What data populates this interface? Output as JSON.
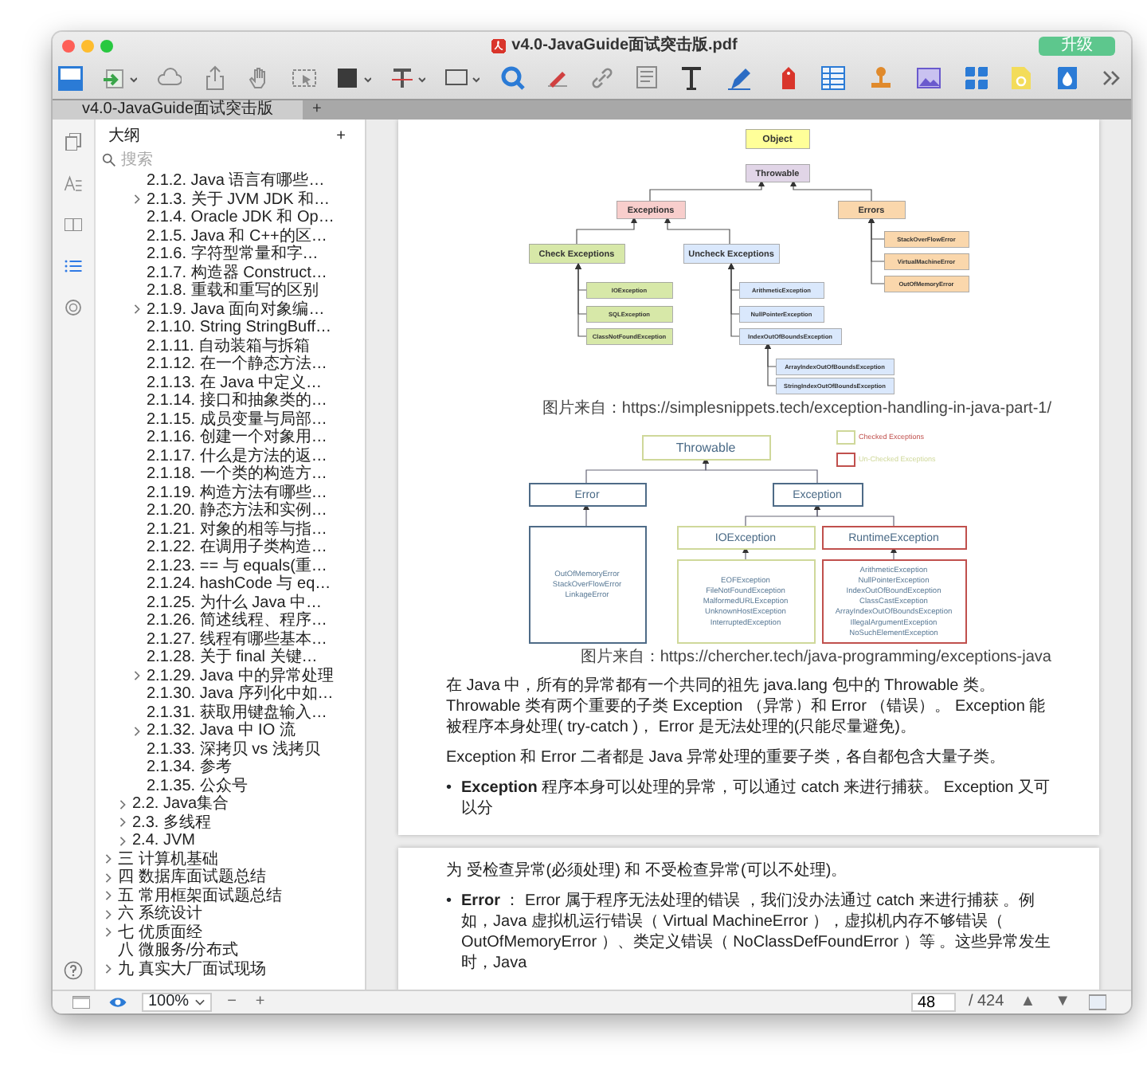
{
  "window": {
    "title": "v4.0-JavaGuide面试突击版.pdf",
    "upgrade_button": "升级"
  },
  "tabs": [
    {
      "label": "v4.0-JavaGuide面试突击版",
      "selected": true
    }
  ],
  "new_tab": "+",
  "rail": [
    {
      "kind": "pages",
      "selected": false
    },
    {
      "kind": "text",
      "selected": false
    },
    {
      "kind": "book",
      "selected": false
    },
    {
      "kind": "outline",
      "selected": true
    },
    {
      "kind": "ring",
      "selected": false
    }
  ],
  "sidebar": {
    "title": "大纲",
    "add": "+",
    "search": {
      "placeholder": "搜索"
    },
    "items": [
      {
        "children": [
          {
            "children": [
              {
                "label": "2.1.2. Java 语言有哪些…",
                "kind": "leaf"
              },
              {
                "label": "2.1.3. 关于 JVM JDK 和…",
                "kind": "folder"
              },
              {
                "label": "2.1.4. Oracle JDK 和 Op…",
                "kind": "leaf"
              },
              {
                "label": "2.1.5. Java 和 C++的区…",
                "kind": "leaf"
              },
              {
                "label": "2.1.6. 字符型常量和字…",
                "kind": "leaf"
              },
              {
                "label": "2.1.7. 构造器 Construct…",
                "kind": "leaf"
              },
              {
                "label": "2.1.8. 重载和重写的区别",
                "kind": "leaf"
              },
              {
                "label": "2.1.9. Java 面向对象编…",
                "kind": "folder"
              },
              {
                "label": "2.1.10. String StringBuff…",
                "kind": "leaf"
              },
              {
                "label": "2.1.11. 自动装箱与拆箱",
                "kind": "leaf"
              },
              {
                "label": "2.1.12. 在一个静态方法…",
                "kind": "leaf"
              },
              {
                "label": "2.1.13. 在 Java 中定义…",
                "kind": "leaf"
              },
              {
                "label": "2.1.14. 接口和抽象类的…",
                "kind": "leaf"
              },
              {
                "label": "2.1.15. 成员变量与局部…",
                "kind": "leaf"
              },
              {
                "label": "2.1.16. 创建一个对象用…",
                "kind": "leaf"
              },
              {
                "label": "2.1.17. 什么是方法的返…",
                "kind": "leaf"
              },
              {
                "label": "2.1.18. 一个类的构造方…",
                "kind": "leaf"
              },
              {
                "label": "2.1.19. 构造方法有哪些…",
                "kind": "leaf"
              },
              {
                "label": "2.1.20. 静态方法和实例…",
                "kind": "leaf"
              },
              {
                "label": "2.1.21. 对象的相等与指…",
                "kind": "leaf"
              },
              {
                "label": "2.1.22. 在调用子类构造…",
                "kind": "leaf"
              },
              {
                "label": "2.1.23. == 与 equals(重…",
                "kind": "leaf"
              },
              {
                "label": "2.1.24. hashCode 与 eq…",
                "kind": "leaf"
              },
              {
                "label": "2.1.25. 为什么 Java 中…",
                "kind": "leaf"
              },
              {
                "label": "2.1.26. 简述线程、程序…",
                "kind": "leaf"
              },
              {
                "label": "2.1.27. 线程有哪些基本…",
                "kind": "leaf"
              },
              {
                "label": "2.1.28. 关于 final 关键…",
                "kind": "leaf"
              },
              {
                "label": "2.1.29. Java 中的异常处理",
                "kind": "folder"
              },
              {
                "label": "2.1.30. Java 序列化中如…",
                "kind": "leaf"
              },
              {
                "label": "2.1.31. 获取用键盘输入…",
                "kind": "leaf"
              },
              {
                "label": "2.1.32. Java 中 IO 流",
                "kind": "folder"
              },
              {
                "label": "2.1.33. 深拷贝 vs 浅拷贝",
                "kind": "leaf"
              },
              {
                "label": "2.1.34. 参考",
                "kind": "leaf"
              },
              {
                "label": "2.1.35. 公众号",
                "kind": "leaf"
              }
            ]
          },
          {
            "label": "2.2. Java集合",
            "kind": "folder"
          },
          {
            "label": "2.3. 多线程",
            "kind": "folder"
          },
          {
            "label": "2.4. JVM",
            "kind": "folder"
          }
        ]
      },
      {
        "label": "三 计算机基础",
        "kind": "folder"
      },
      {
        "label": "四 数据库面试题总结",
        "kind": "folder"
      },
      {
        "label": "五 常用框架面试题总结",
        "kind": "folder"
      },
      {
        "label": "六 系统设计",
        "kind": "folder"
      },
      {
        "label": "七 优质面经",
        "kind": "folder"
      },
      {
        "label": "八 微服务/分布式",
        "kind": "leaf"
      },
      {
        "label": "九 真实大厂面试现场",
        "kind": "folder"
      }
    ]
  },
  "pages": [
    {
      "blocks": [
        {
          "kind": "tree_figure",
          "nodes": [
            {
              "label": "Object",
              "color": "#ffff99"
            },
            {
              "label": "Throwable",
              "color": "#e1d5e7"
            },
            {
              "label": "Exceptions",
              "color": "#f8cecc"
            },
            {
              "label": "Errors",
              "color": "#fad7ac"
            },
            {
              "label": "Check Exceptions",
              "color": "#d7e8a8"
            },
            {
              "label": "Uncheck Exceptions",
              "color": "#dae8fc"
            },
            {
              "label": "IOException",
              "color": "#d7e8a8"
            },
            {
              "label": "SQLException",
              "color": "#d7e8a8"
            },
            {
              "label": "ClassNotFoundException",
              "color": "#d7e8a8"
            },
            {
              "label": "ArithmeticException",
              "color": "#dae8fc"
            },
            {
              "label": "NullPointerException",
              "color": "#dae8fc"
            },
            {
              "label": "IndexOutOfBoundsException",
              "color": "#dae8fc"
            },
            {
              "label": "ArrayIndexOutOfBoundsException",
              "color": "#dae8fc"
            },
            {
              "label": "StringIndexOutOfBoundsException",
              "color": "#dae8fc"
            },
            {
              "label": "StackOverFlowError",
              "color": "#fad7ac"
            },
            {
              "label": "VirtualMachineError",
              "color": "#fad7ac"
            },
            {
              "label": "OutOfMemoryError",
              "color": "#fad7ac"
            }
          ]
        },
        {
          "kind": "caption",
          "text": "图片来自：https://simplesnippets.tech/exception-handling-in-java-part-1/"
        },
        {
          "kind": "box_figure",
          "legend": [
            {
              "label": "Checked Exceptions",
              "color": "#cfd89a"
            },
            {
              "label": "Un-Checked Exceptions",
              "color": "#c0504d"
            }
          ],
          "nodes": [
            {
              "label": "Throwable",
              "color": "#cfd89a"
            },
            {
              "label": "Error",
              "color": "#4e6b87"
            },
            {
              "label": "Exception",
              "color": "#4e6b87"
            },
            {
              "label": "IOException",
              "color": "#cfd89a"
            },
            {
              "label": "RuntimeException",
              "color": "#c0504d"
            }
          ],
          "lists": [
            {
              "color": "#4e6b87",
              "items": [
                "OutOfMemoryError",
                "StackOverFlowError",
                "LinkageError"
              ]
            },
            {
              "color": "#cfd89a",
              "items": [
                "EOFException",
                "FileNotFoundException",
                "MalformedURLException",
                "UnknownHostException",
                "InterruptedException"
              ]
            },
            {
              "color": "#c0504d",
              "items": [
                "ArithmeticException",
                "NullPointerException",
                "IndexOutOfBoundException",
                "ClassCastException",
                "ArrayIndexOutOfBoundsException",
                "IllegalArgumentException",
                "NoSuchElementException"
              ]
            }
          ]
        },
        {
          "kind": "caption",
          "text": "图片来自：https://chercher.tech/java-programming/exceptions-java"
        },
        {
          "kind": "paragraph",
          "text": "在 Java 中，所有的异常都有一个共同的祖先 java.lang 包中的 Throwable 类。 Throwable 类有两个重要的子类 Exception （异常）和 Error （错误）。 Exception 能被程序本身处理( try-catch )， Error 是无法处理的(只能尽量避免)。"
        },
        {
          "kind": "paragraph",
          "text": "Exception 和 Error 二者都是 Java 异常处理的重要子类，各自都包含大量子类。"
        },
        {
          "kind": "bullet",
          "marker": "•",
          "text": "**Exception** 程序本身可以处理的异常，可以通过 catch 来进行捕获。 Exception 又可以分"
        }
      ]
    },
    {
      "blocks": [
        {
          "kind": "paragraph",
          "text": "为 受检查异常(必须处理) 和 不受检查异常(可以不处理)。"
        },
        {
          "kind": "bullet",
          "marker": "•",
          "text": "**Error** ： Error 属于程序无法处理的错误 ，我们没办法通过 catch 来进行捕获 。例如，Java 虚拟机运行错误（ Virtual MachineError ），虚拟机内存不够错误（ OutOfMemoryError ）、类定义错误（ NoClassDefFoundError ）等 。这些异常发生时，Java"
        }
      ]
    }
  ],
  "status_bar": {
    "zoom": "100%",
    "zoom_out": "−",
    "zoom_in": "+",
    "page": "48",
    "page_count": "/ 424",
    "prev_page": "▲",
    "next_page": "▼"
  }
}
